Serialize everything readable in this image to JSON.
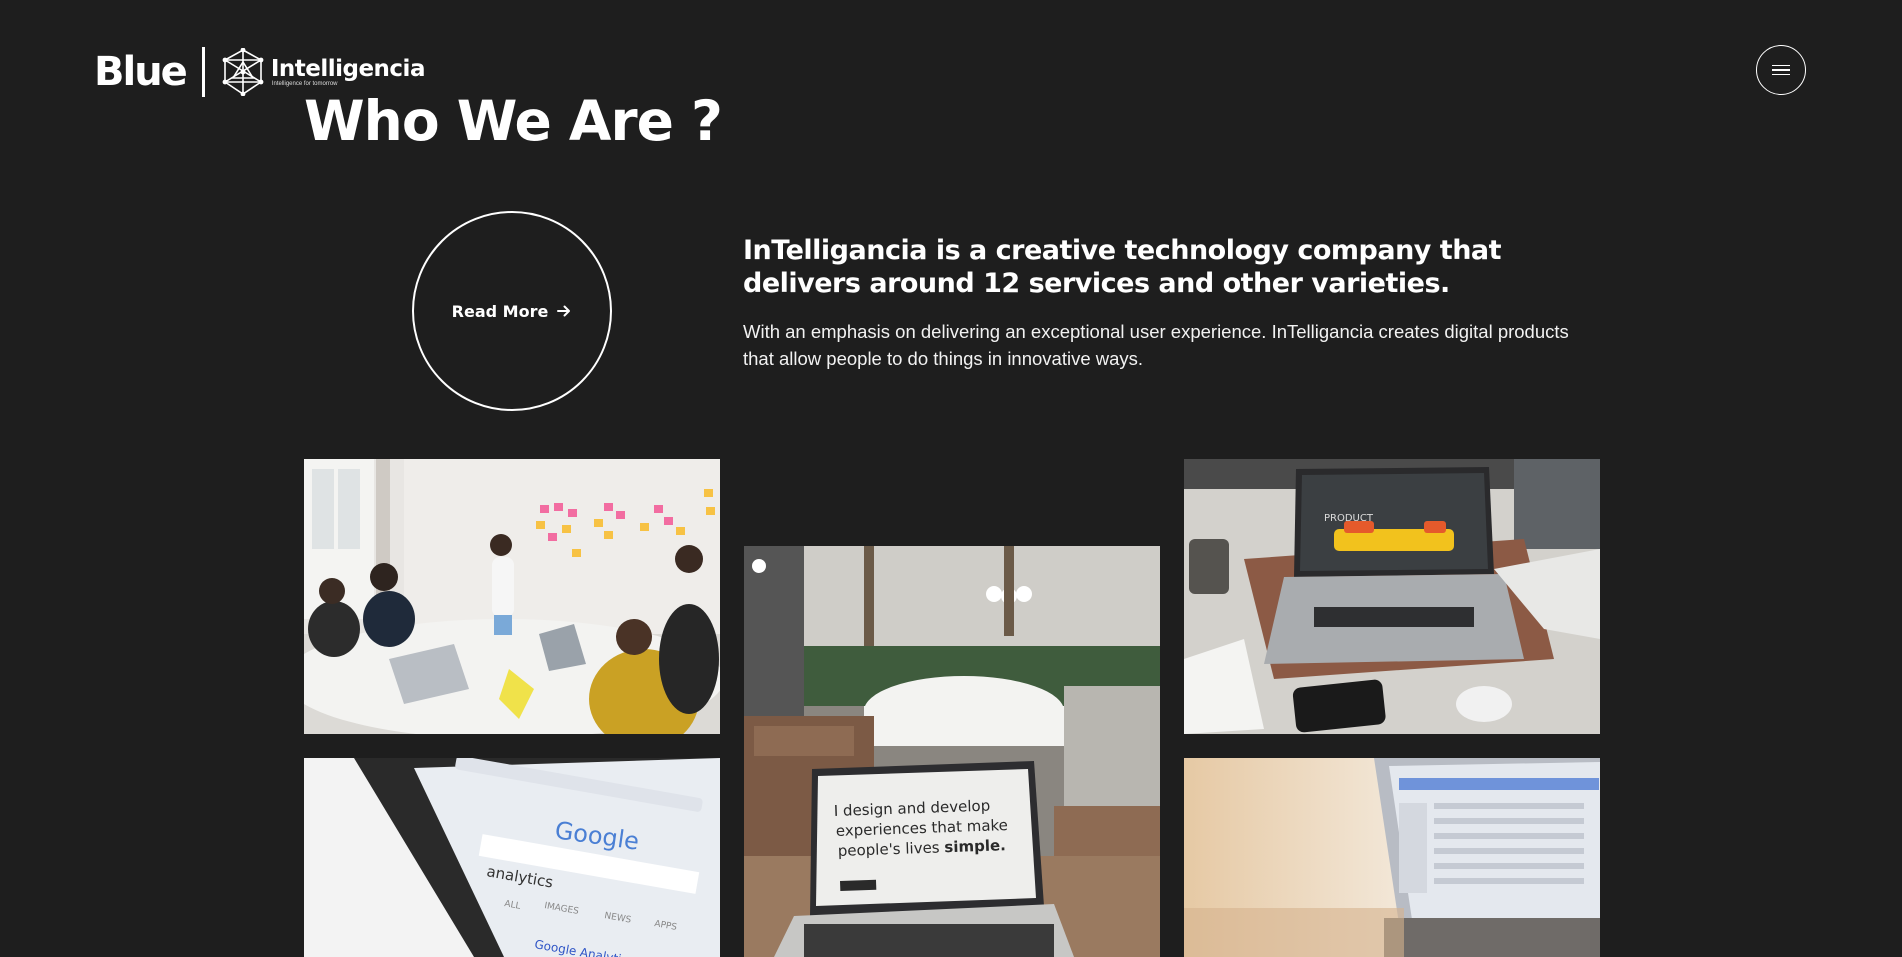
{
  "header": {
    "logo_primary": "Blue",
    "logo_secondary": "Intelligencia",
    "logo_tagline": "Intelligence for tomorrow",
    "menu_icon": "hamburger-icon"
  },
  "page": {
    "title": "Who We Are ?"
  },
  "read_more": {
    "label": "Read More",
    "icon": "arrow-right-icon"
  },
  "intro": {
    "heading": "InTelligancia is a creative technology company that delivers around 12 services and other varieties.",
    "body": "With an emphasis on delivering an exceptional user experience. InTelligancia creates digital products that allow people to do things in innovative ways."
  },
  "gallery": {
    "laptop_screen": {
      "line1": "I design and develop",
      "line2": "experiences that make",
      "line3": "people's lives",
      "emphasis": "simple."
    },
    "product_screen": "PRODUCT",
    "phone_screen": {
      "search_brand": "Google",
      "query": "analytics",
      "tabs": [
        "ALL",
        "IMAGES",
        "NEWS",
        "APPS"
      ],
      "result": "Google Analytics - Mobile, Premium"
    }
  },
  "colors": {
    "background": "#1e1e1e",
    "text": "#ffffff"
  }
}
